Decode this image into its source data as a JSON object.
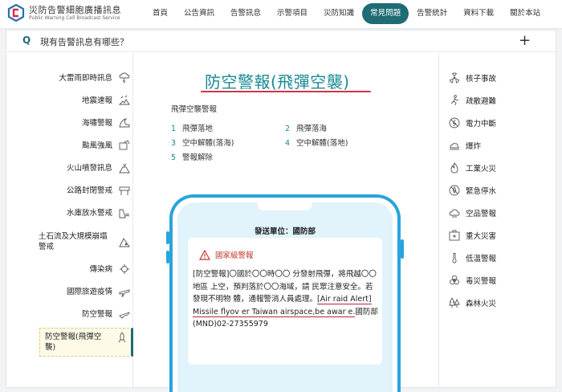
{
  "header": {
    "brand_title": "災防告警細胞廣播訊息",
    "brand_subtitle": "Public Warning Cell Broadcast Service",
    "nav": [
      {
        "label": "首頁",
        "active": false
      },
      {
        "label": "公告資訊",
        "active": false
      },
      {
        "label": "告警訊息",
        "active": false
      },
      {
        "label": "示警項目",
        "active": false
      },
      {
        "label": "災防知識",
        "active": false
      },
      {
        "label": "常見問題",
        "active": true
      },
      {
        "label": "告警統計",
        "active": false
      },
      {
        "label": "資料下載",
        "active": false
      },
      {
        "label": "關於本站",
        "active": false
      }
    ],
    "accent_color": "#1f6c74"
  },
  "question": {
    "mark": "Q",
    "text": "現有告警訊息有哪些？",
    "toggle": "+"
  },
  "left_menu": [
    {
      "label": "大雷雨即時訊息",
      "icon": "thunderstorm-icon"
    },
    {
      "label": "地震速報",
      "icon": "earthquake-icon"
    },
    {
      "label": "海嘯警報",
      "icon": "tsunami-icon"
    },
    {
      "label": "颱風強風",
      "icon": "typhoon-icon"
    },
    {
      "label": "火山噴發訊息",
      "icon": "volcano-icon"
    },
    {
      "label": "公路封閉警戒",
      "icon": "road-closure-icon"
    },
    {
      "label": "水庫放水警戒",
      "icon": "reservoir-icon"
    },
    {
      "label": "土石流及大規模崩塌警戒",
      "icon": "landslide-icon"
    },
    {
      "label": "傳染病",
      "icon": "virus-icon"
    },
    {
      "label": "國際旅遊疫情",
      "icon": "travel-icon"
    },
    {
      "label": "防空警報",
      "icon": "air-raid-icon"
    },
    {
      "label": "防空警報(飛彈空襲)",
      "icon": "missile-icon",
      "active": true
    }
  ],
  "right_menu": [
    {
      "label": "核子事故",
      "icon": "radiation-icon"
    },
    {
      "label": "疏散避難",
      "icon": "evacuation-icon"
    },
    {
      "label": "電力中斷",
      "icon": "power-outage-icon"
    },
    {
      "label": "爆炸",
      "icon": "explosion-icon"
    },
    {
      "label": "工業火災",
      "icon": "fire-icon"
    },
    {
      "label": "緊急停水",
      "icon": "water-stop-icon"
    },
    {
      "label": "空品警報",
      "icon": "air-quality-icon"
    },
    {
      "label": "重大災害",
      "icon": "first-aid-icon"
    },
    {
      "label": "低溫警報",
      "icon": "thermometer-icon"
    },
    {
      "label": "毒災警報",
      "icon": "biohazard-icon"
    },
    {
      "label": "森林火災",
      "icon": "forest-fire-icon"
    }
  ],
  "content": {
    "title": "防空警報(飛彈空襲)",
    "subtitle": "飛彈空襲警報",
    "steps": [
      {
        "num": "1",
        "label": "飛彈落地"
      },
      {
        "num": "2",
        "label": "飛彈落海"
      },
      {
        "num": "3",
        "label": "空中解體(落海)"
      },
      {
        "num": "4",
        "label": "空中解體(落地)"
      },
      {
        "num": "5",
        "label": "警報解除"
      }
    ],
    "title_color": "#178a94",
    "underline_color": "#d2324a"
  },
  "phone": {
    "sender": "發送單位：國防部",
    "level": "國家級警報",
    "message_zh": "[防空警報]〇國於〇〇時〇〇 分發射飛彈，將飛越〇〇地區 上空，預判落於〇〇海域，請 民眾注意安全。若發現不明物 體，通報警消人員處理。",
    "message_en": "[Air raid Alert] Missile flyov er Taiwan airspace,be awar e.",
    "message_tail": "國防部(MND)02-27355979",
    "frame_color": "#29a4dd"
  }
}
